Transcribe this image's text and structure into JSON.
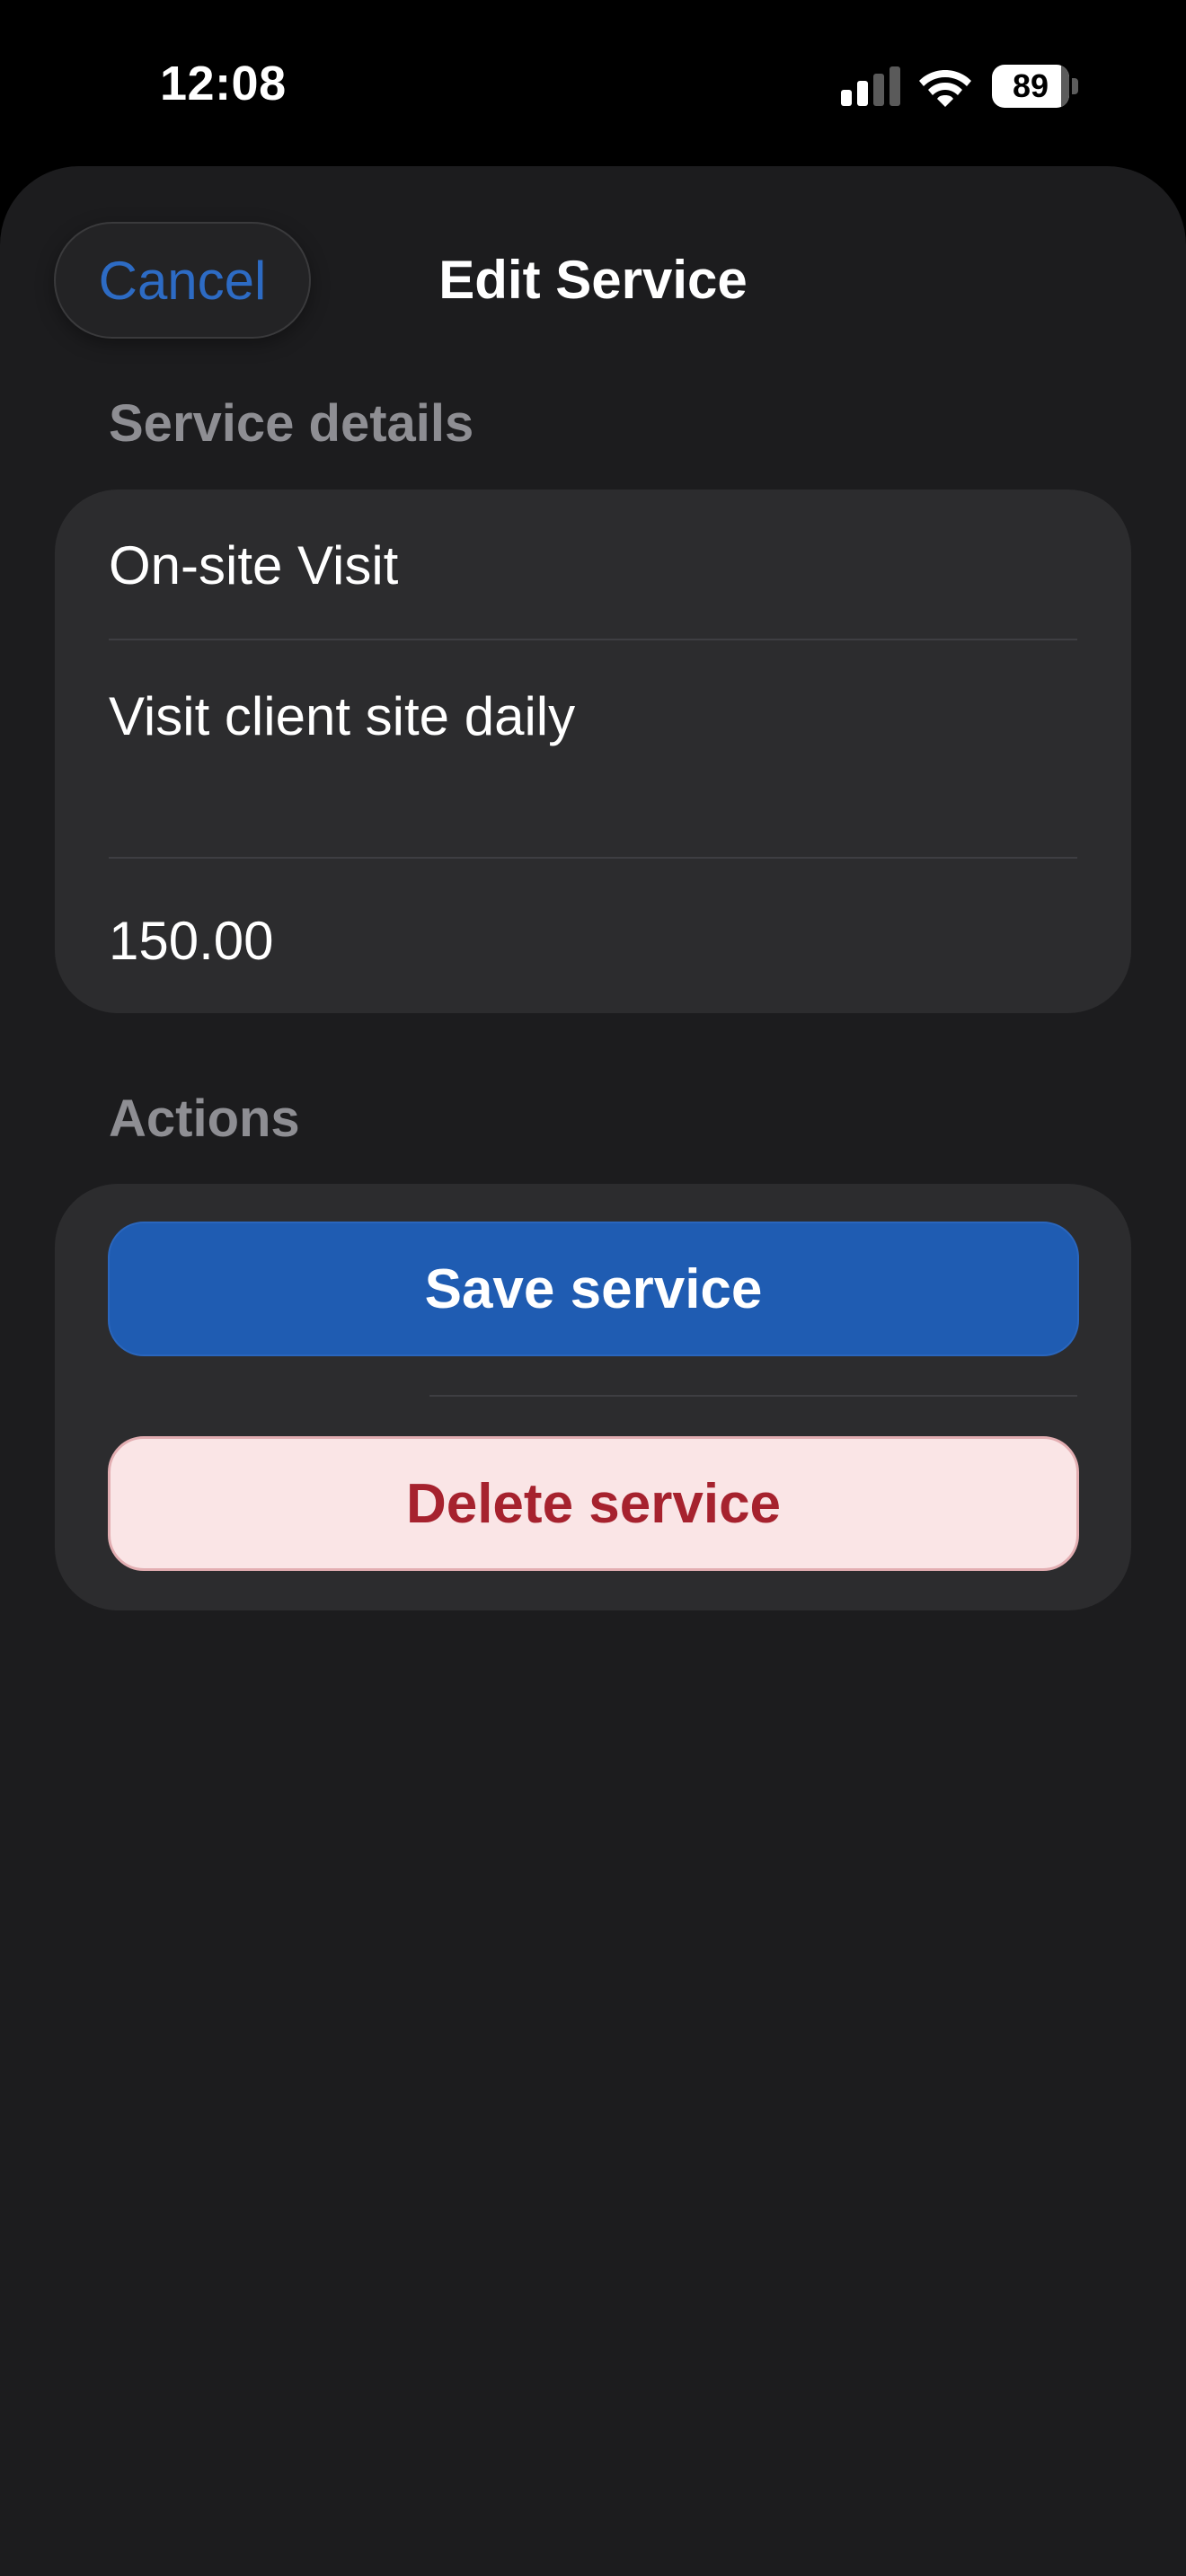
{
  "status_bar": {
    "time": "12:08",
    "battery_level": "89",
    "battery_fraction": 0.89,
    "signal_icon": "cellular-signal-icon",
    "wifi_icon": "wifi-icon"
  },
  "header": {
    "title": "Edit Service",
    "cancel_label": "Cancel"
  },
  "sections": {
    "details": {
      "header": "Service details",
      "name_value": "On-site Visit",
      "description_value": "Visit client site daily",
      "price_value": "150.00"
    },
    "actions": {
      "header": "Actions",
      "save_label": "Save service",
      "delete_label": "Delete service"
    }
  },
  "colors": {
    "background": "#000000",
    "sheet": "#1c1c1e",
    "card": "#2c2c2e",
    "accent_blue": "#2d6bc4",
    "save_fill": "#1f5cb2",
    "delete_fill": "#fae5e6",
    "delete_text": "#a6222e",
    "secondary_text": "#8e8e93"
  }
}
